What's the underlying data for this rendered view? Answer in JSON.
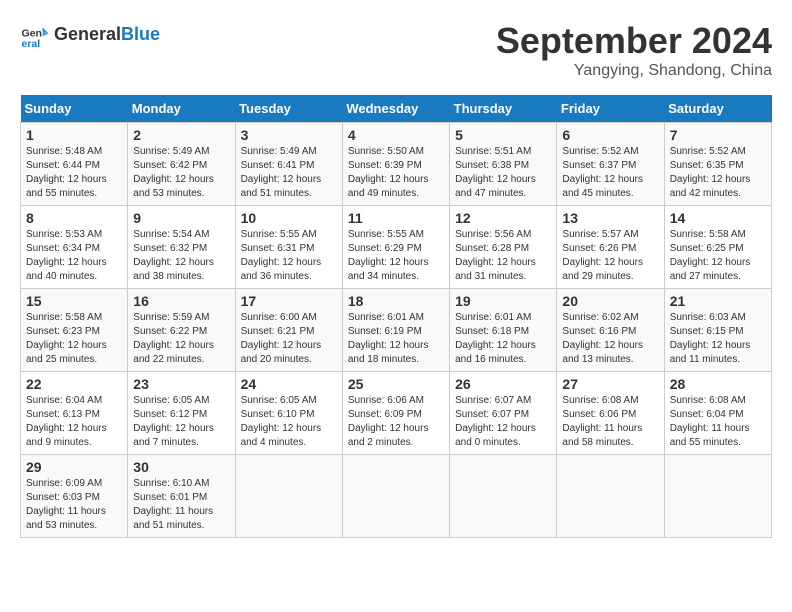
{
  "header": {
    "logo_line1": "General",
    "logo_line2": "Blue",
    "month": "September 2024",
    "location": "Yangying, Shandong, China"
  },
  "days_of_week": [
    "Sunday",
    "Monday",
    "Tuesday",
    "Wednesday",
    "Thursday",
    "Friday",
    "Saturday"
  ],
  "weeks": [
    [
      {
        "day": 1,
        "sunrise": "5:48 AM",
        "sunset": "6:44 PM",
        "daylight": "12 hours and 55 minutes."
      },
      {
        "day": 2,
        "sunrise": "5:49 AM",
        "sunset": "6:42 PM",
        "daylight": "12 hours and 53 minutes."
      },
      {
        "day": 3,
        "sunrise": "5:49 AM",
        "sunset": "6:41 PM",
        "daylight": "12 hours and 51 minutes."
      },
      {
        "day": 4,
        "sunrise": "5:50 AM",
        "sunset": "6:39 PM",
        "daylight": "12 hours and 49 minutes."
      },
      {
        "day": 5,
        "sunrise": "5:51 AM",
        "sunset": "6:38 PM",
        "daylight": "12 hours and 47 minutes."
      },
      {
        "day": 6,
        "sunrise": "5:52 AM",
        "sunset": "6:37 PM",
        "daylight": "12 hours and 45 minutes."
      },
      {
        "day": 7,
        "sunrise": "5:52 AM",
        "sunset": "6:35 PM",
        "daylight": "12 hours and 42 minutes."
      }
    ],
    [
      {
        "day": 8,
        "sunrise": "5:53 AM",
        "sunset": "6:34 PM",
        "daylight": "12 hours and 40 minutes."
      },
      {
        "day": 9,
        "sunrise": "5:54 AM",
        "sunset": "6:32 PM",
        "daylight": "12 hours and 38 minutes."
      },
      {
        "day": 10,
        "sunrise": "5:55 AM",
        "sunset": "6:31 PM",
        "daylight": "12 hours and 36 minutes."
      },
      {
        "day": 11,
        "sunrise": "5:55 AM",
        "sunset": "6:29 PM",
        "daylight": "12 hours and 34 minutes."
      },
      {
        "day": 12,
        "sunrise": "5:56 AM",
        "sunset": "6:28 PM",
        "daylight": "12 hours and 31 minutes."
      },
      {
        "day": 13,
        "sunrise": "5:57 AM",
        "sunset": "6:26 PM",
        "daylight": "12 hours and 29 minutes."
      },
      {
        "day": 14,
        "sunrise": "5:58 AM",
        "sunset": "6:25 PM",
        "daylight": "12 hours and 27 minutes."
      }
    ],
    [
      {
        "day": 15,
        "sunrise": "5:58 AM",
        "sunset": "6:23 PM",
        "daylight": "12 hours and 25 minutes."
      },
      {
        "day": 16,
        "sunrise": "5:59 AM",
        "sunset": "6:22 PM",
        "daylight": "12 hours and 22 minutes."
      },
      {
        "day": 17,
        "sunrise": "6:00 AM",
        "sunset": "6:21 PM",
        "daylight": "12 hours and 20 minutes."
      },
      {
        "day": 18,
        "sunrise": "6:01 AM",
        "sunset": "6:19 PM",
        "daylight": "12 hours and 18 minutes."
      },
      {
        "day": 19,
        "sunrise": "6:01 AM",
        "sunset": "6:18 PM",
        "daylight": "12 hours and 16 minutes."
      },
      {
        "day": 20,
        "sunrise": "6:02 AM",
        "sunset": "6:16 PM",
        "daylight": "12 hours and 13 minutes."
      },
      {
        "day": 21,
        "sunrise": "6:03 AM",
        "sunset": "6:15 PM",
        "daylight": "12 hours and 11 minutes."
      }
    ],
    [
      {
        "day": 22,
        "sunrise": "6:04 AM",
        "sunset": "6:13 PM",
        "daylight": "12 hours and 9 minutes."
      },
      {
        "day": 23,
        "sunrise": "6:05 AM",
        "sunset": "6:12 PM",
        "daylight": "12 hours and 7 minutes."
      },
      {
        "day": 24,
        "sunrise": "6:05 AM",
        "sunset": "6:10 PM",
        "daylight": "12 hours and 4 minutes."
      },
      {
        "day": 25,
        "sunrise": "6:06 AM",
        "sunset": "6:09 PM",
        "daylight": "12 hours and 2 minutes."
      },
      {
        "day": 26,
        "sunrise": "6:07 AM",
        "sunset": "6:07 PM",
        "daylight": "12 hours and 0 minutes."
      },
      {
        "day": 27,
        "sunrise": "6:08 AM",
        "sunset": "6:06 PM",
        "daylight": "11 hours and 58 minutes."
      },
      {
        "day": 28,
        "sunrise": "6:08 AM",
        "sunset": "6:04 PM",
        "daylight": "11 hours and 55 minutes."
      }
    ],
    [
      {
        "day": 29,
        "sunrise": "6:09 AM",
        "sunset": "6:03 PM",
        "daylight": "11 hours and 53 minutes."
      },
      {
        "day": 30,
        "sunrise": "6:10 AM",
        "sunset": "6:01 PM",
        "daylight": "11 hours and 51 minutes."
      },
      null,
      null,
      null,
      null,
      null
    ]
  ]
}
